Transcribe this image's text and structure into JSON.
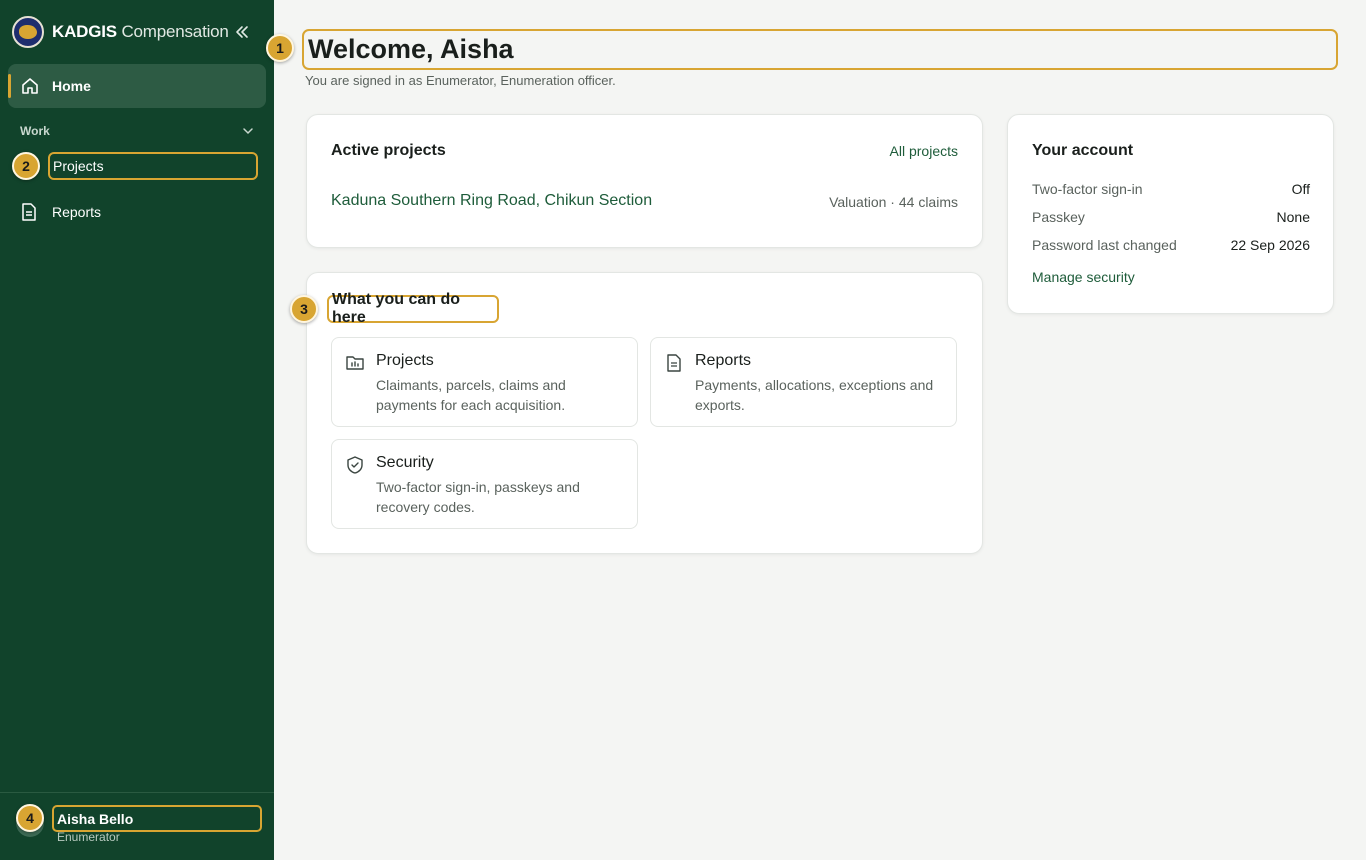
{
  "app": {
    "brand_bold": "KADGIS",
    "brand_rest": "Compensation"
  },
  "sidebar": {
    "home_label": "Home",
    "section_label": "Work",
    "projects_label": "Projects",
    "reports_label": "Reports"
  },
  "user": {
    "name": "Aisha Bello",
    "role": "Enumerator"
  },
  "header": {
    "title": "Welcome, Aisha",
    "subtitle": "You are signed in as Enumerator, Enumeration officer."
  },
  "projects_card": {
    "title": "Active projects",
    "link": "All projects",
    "project_name": "Kaduna Southern Ring Road, Chikun Section",
    "project_meta": "Valuation · 44 claims"
  },
  "actions_card": {
    "title": "What you can do here",
    "tiles": [
      {
        "title": "Projects",
        "desc": "Claimants, parcels, claims and payments for each acquisition.",
        "icon": "folder-chart-icon"
      },
      {
        "title": "Reports",
        "desc": "Payments, allocations, exceptions and exports.",
        "icon": "document-icon"
      },
      {
        "title": "Security",
        "desc": "Two-factor sign-in, passkeys and recovery codes.",
        "icon": "shield-check-icon"
      }
    ]
  },
  "account_card": {
    "title": "Your account",
    "rows": [
      {
        "label": "Two-factor sign-in",
        "value": "Off"
      },
      {
        "label": "Passkey",
        "value": "None"
      },
      {
        "label": "Password last changed",
        "value": "22 Sep 2026"
      }
    ],
    "manage_link": "Manage security"
  },
  "badges": [
    "1",
    "2",
    "3",
    "4"
  ],
  "colors": {
    "sidebar_bg": "#11432b",
    "accent_gold": "#d8a532",
    "link_green": "#1e5c3a"
  }
}
